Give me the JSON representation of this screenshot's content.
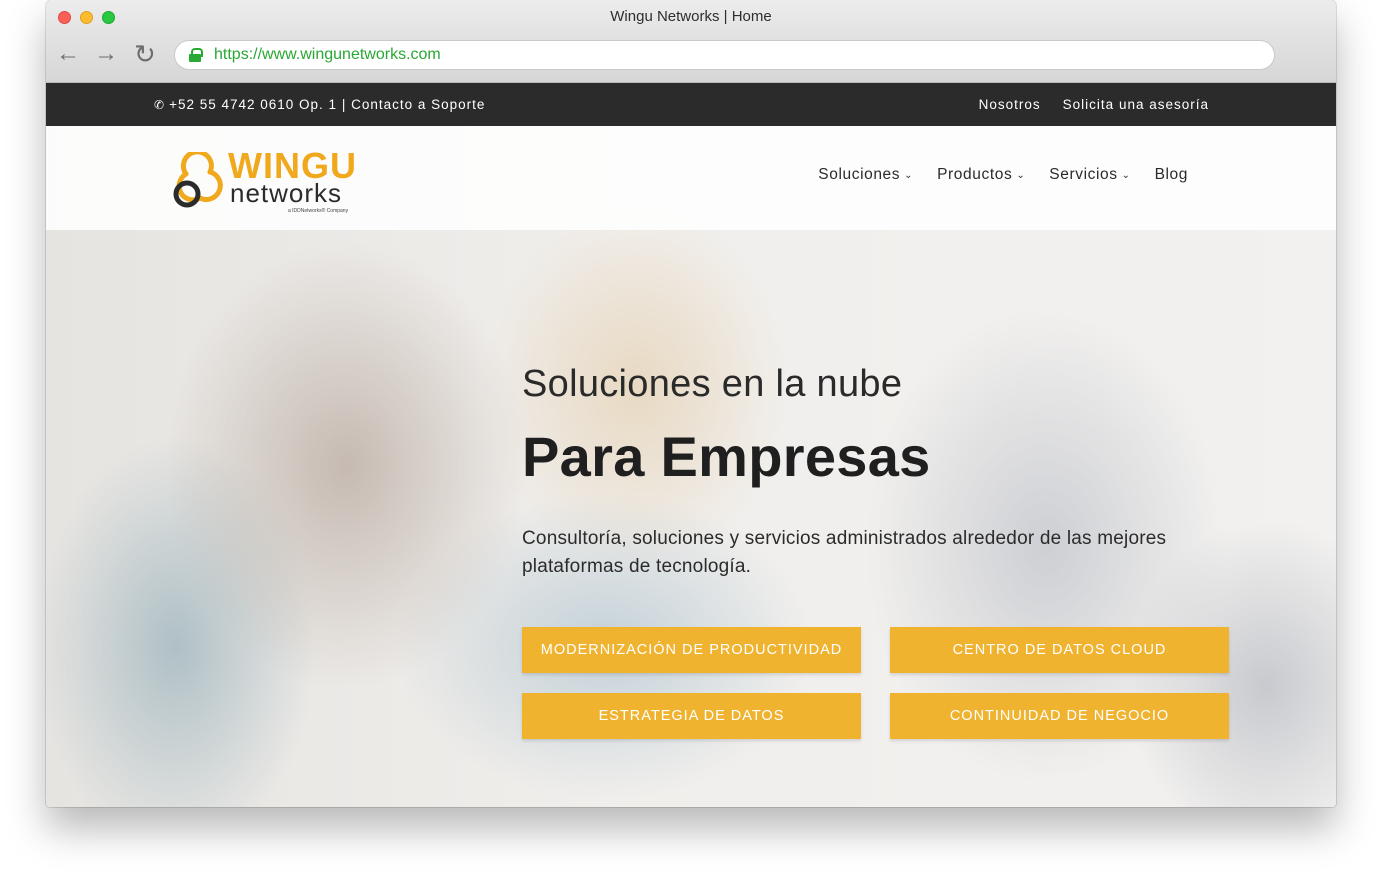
{
  "browser": {
    "title": "Wingu Networks | Home",
    "url": "https://www.wingunetworks.com",
    "back_icon": "←",
    "forward_icon": "→",
    "reload_icon": "↻"
  },
  "topbar": {
    "contact": "+52 55 4742 0610 Op. 1 | Contacto a Soporte",
    "phone_icon": "✆",
    "links": [
      "Nosotros",
      "Solicita una asesoría"
    ]
  },
  "logo": {
    "brand_top": "WINGU",
    "brand_bottom": "networks",
    "tagline": "a IDDNetworks® Company"
  },
  "nav": {
    "items": [
      {
        "label": "Soluciones",
        "has_dropdown": true
      },
      {
        "label": "Productos",
        "has_dropdown": true
      },
      {
        "label": "Servicios",
        "has_dropdown": true
      },
      {
        "label": "Blog",
        "has_dropdown": false
      }
    ],
    "chevron": "⌄"
  },
  "hero": {
    "subtitle": "Soluciones en la nube",
    "title": "Para Empresas",
    "description": "Consultoría, soluciones y servicios administrados alrededor de las mejores plataformas de tecnología.",
    "buttons": [
      "MODERNIZACIÓN DE PRODUCTIVIDAD",
      "CENTRO DE DATOS CLOUD",
      "ESTRATEGIA DE DATOS",
      "CONTINUIDAD DE NEGOCIO"
    ]
  },
  "colors": {
    "accent": "#f0b330",
    "topbar_bg": "#2b2b2b",
    "url_green": "#29a833"
  }
}
